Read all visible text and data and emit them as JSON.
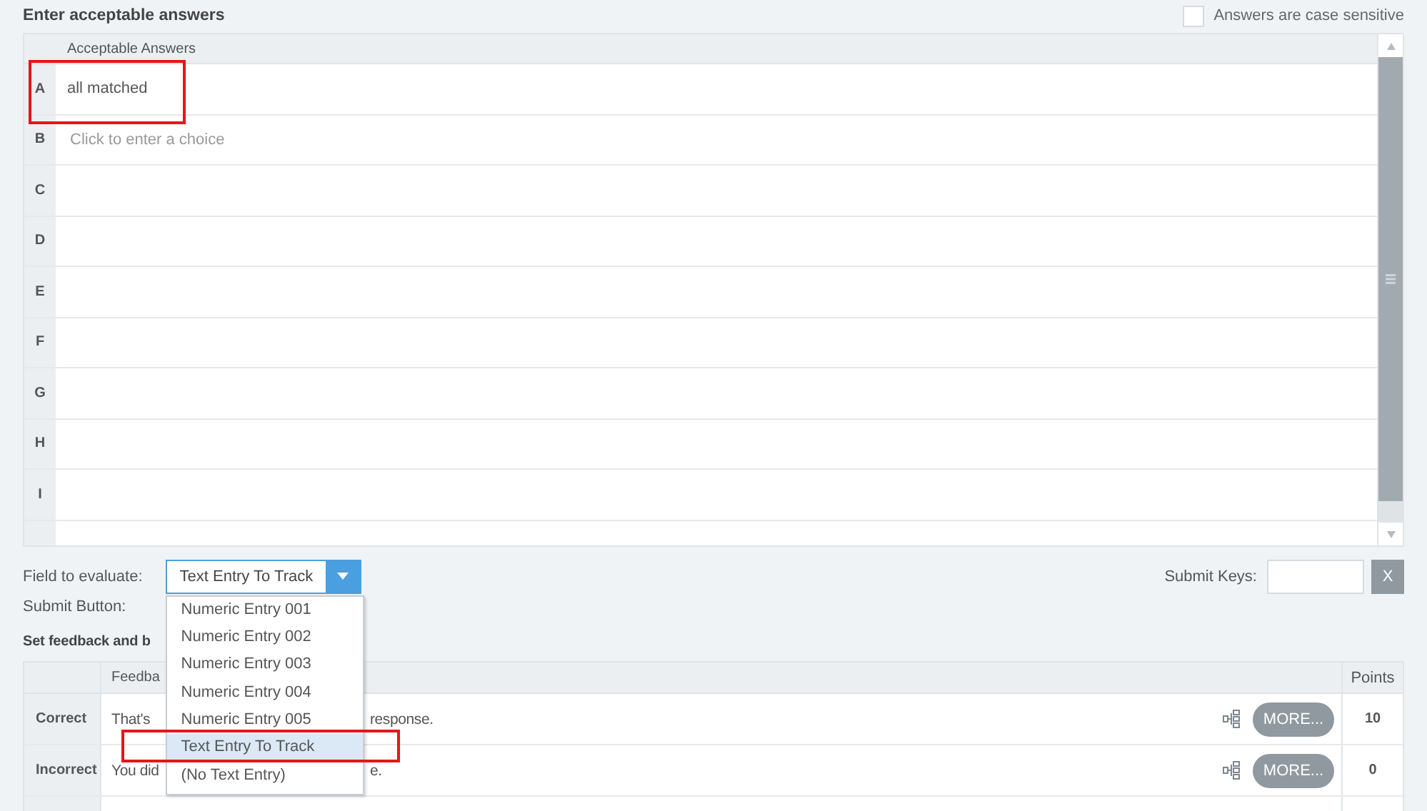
{
  "section_title": "Enter acceptable answers",
  "case_sensitive": {
    "label": "Answers are case sensitive",
    "checked": false
  },
  "answers": {
    "column": "Acceptable Answers",
    "rows": [
      {
        "letter": "A",
        "value": "all matched",
        "highlighted": true
      },
      {
        "letter": "B",
        "placeholder": "Click to enter a choice",
        "highlighted": false
      },
      {
        "letter": "C",
        "highlighted": false
      },
      {
        "letter": "D",
        "highlighted": false
      },
      {
        "letter": "E",
        "highlighted": false
      },
      {
        "letter": "F",
        "highlighted": false
      },
      {
        "letter": "G",
        "highlighted": false
      },
      {
        "letter": "H",
        "highlighted": false
      },
      {
        "letter": "I",
        "highlighted": false
      }
    ]
  },
  "field_to_evaluate": {
    "label": "Field to evaluate:",
    "value": "Text Entry To Track",
    "options": [
      {
        "label": "Numeric Entry 001",
        "selected": false,
        "highlighted": false
      },
      {
        "label": "Numeric Entry 002",
        "selected": false,
        "highlighted": false
      },
      {
        "label": "Numeric Entry 003",
        "selected": false,
        "highlighted": false
      },
      {
        "label": "Numeric Entry 004",
        "selected": false,
        "highlighted": false
      },
      {
        "label": "Numeric Entry 005",
        "selected": false,
        "highlighted": false
      },
      {
        "label": "Text Entry To Track",
        "selected": true,
        "highlighted": true
      },
      {
        "label": "(No Text Entry)",
        "selected": false,
        "highlighted": false
      }
    ]
  },
  "submit_button": {
    "label": "Submit Button:"
  },
  "submit_keys": {
    "label": "Submit Keys:",
    "clear_button": "X"
  },
  "feedback_title": "Set feedback and b",
  "feedback_table": {
    "columns": [
      "Feedba",
      "Points"
    ],
    "rows": [
      {
        "label": "Correct",
        "text_left": "That's",
        "text_right": "response.",
        "more": "MORE...",
        "points": "10"
      },
      {
        "label": "Incorrect",
        "text_left": "You did",
        "text_right": "e.",
        "more": "MORE...",
        "points": "0"
      }
    ]
  }
}
